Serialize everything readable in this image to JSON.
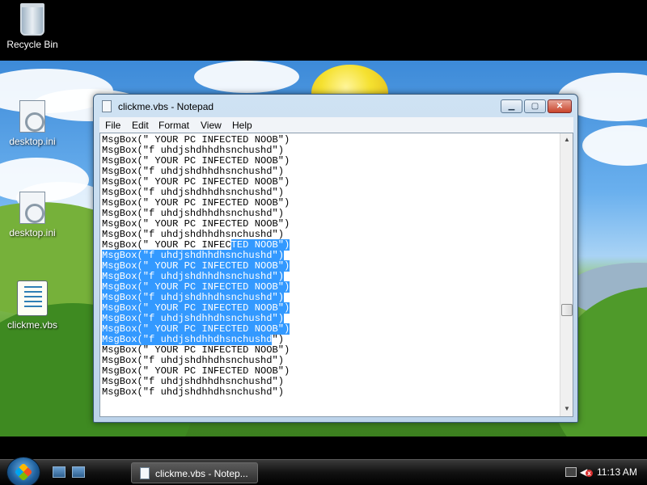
{
  "desktop": {
    "icons": [
      {
        "label": "Recycle Bin"
      },
      {
        "label": "desktop.ini"
      },
      {
        "label": "desktop.ini"
      },
      {
        "label": "clickme.vbs"
      }
    ]
  },
  "window": {
    "title": "clickme.vbs - Notepad",
    "controls": {
      "minimize": "▁",
      "maximize": "▢",
      "close": "✕"
    }
  },
  "menu": [
    "File",
    "Edit",
    "Format",
    "View",
    "Help"
  ],
  "editor": {
    "lines": [
      {
        "pre": "MsgBox(\" YOUR PC INFECTED NOOB\")",
        "sel": ""
      },
      {
        "pre": "MsgBox(\"f uhdjshdhhdhsnchushd\")",
        "sel": ""
      },
      {
        "pre": "MsgBox(\" YOUR PC INFECTED NOOB\")",
        "sel": ""
      },
      {
        "pre": "MsgBox(\"f uhdjshdhhdhsnchushd\")",
        "sel": ""
      },
      {
        "pre": "MsgBox(\" YOUR PC INFECTED NOOB\")",
        "sel": ""
      },
      {
        "pre": "MsgBox(\"f uhdjshdhhdhsnchushd\")",
        "sel": ""
      },
      {
        "pre": "MsgBox(\" YOUR PC INFECTED NOOB\")",
        "sel": ""
      },
      {
        "pre": "MsgBox(\"f uhdjshdhhdhsnchushd\")",
        "sel": ""
      },
      {
        "pre": "MsgBox(\" YOUR PC INFECTED NOOB\")",
        "sel": ""
      },
      {
        "pre": "MsgBox(\"f uhdjshdhhdhsnchushd\")",
        "sel": ""
      },
      {
        "pre": "MsgBox(\" YOUR PC INFEC",
        "sel": "TED NOOB\")"
      },
      {
        "pre": "",
        "sel": "MsgBox(\"f uhdjshdhhdhsnchushd\")"
      },
      {
        "pre": "",
        "sel": "MsgBox(\" YOUR PC INFECTED NOOB\")"
      },
      {
        "pre": "",
        "sel": "MsgBox(\"f uhdjshdhhdhsnchushd\")"
      },
      {
        "pre": "",
        "sel": "MsgBox(\" YOUR PC INFECTED NOOB\")"
      },
      {
        "pre": "",
        "sel": "MsgBox(\"f uhdjshdhhdhsnchushd\")"
      },
      {
        "pre": "",
        "sel": "MsgBox(\" YOUR PC INFECTED NOOB\")"
      },
      {
        "pre": "",
        "sel": "MsgBox(\"f uhdjshdhhdhsnchushd\")"
      },
      {
        "pre": "",
        "sel": "MsgBox(\" YOUR PC INFECTED NOOB\")"
      },
      {
        "pre": "",
        "sel": "MsgBox(\"f uhdjshdhhdhsnchushd",
        "post": "\")"
      },
      {
        "pre": "MsgBox(\" YOUR PC INFECTED NOOB\")",
        "sel": ""
      },
      {
        "pre": "MsgBox(\"f uhdjshdhhdhsnchushd\")",
        "sel": ""
      },
      {
        "pre": "MsgBox(\" YOUR PC INFECTED NOOB\")",
        "sel": ""
      },
      {
        "pre": "MsgBox(\"f uhdjshdhhdhsnchushd\")",
        "sel": ""
      },
      {
        "pre": "MsgBox(\"f uhdjshdhhdhsnchushd\")",
        "sel": ""
      }
    ],
    "selection_color": "#3399ff"
  },
  "taskbar": {
    "task_label": "clickme.vbs - Notep...",
    "clock": "11:13 AM",
    "tray_mute": "x"
  },
  "colors": {
    "taskbar": "#121212",
    "title_bg": "#cfe2f3",
    "close_button": "#c9442b"
  },
  "icons": [
    "recycle-bin-icon",
    "ini-file-icon",
    "vbs-script-icon",
    "notepad-icon",
    "start-orb-icon",
    "show-desktop-icon",
    "switch-windows-icon",
    "network-icon",
    "volume-muted-icon"
  ]
}
